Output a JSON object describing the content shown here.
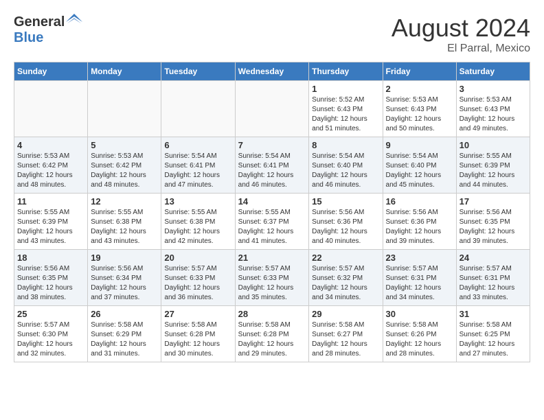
{
  "header": {
    "logo_general": "General",
    "logo_blue": "Blue",
    "title": "August 2024",
    "subtitle": "El Parral, Mexico"
  },
  "days_of_week": [
    "Sunday",
    "Monday",
    "Tuesday",
    "Wednesday",
    "Thursday",
    "Friday",
    "Saturday"
  ],
  "weeks": [
    [
      {
        "day": "",
        "info": ""
      },
      {
        "day": "",
        "info": ""
      },
      {
        "day": "",
        "info": ""
      },
      {
        "day": "",
        "info": ""
      },
      {
        "day": "1",
        "info": "Sunrise: 5:52 AM\nSunset: 6:43 PM\nDaylight: 12 hours\nand 51 minutes."
      },
      {
        "day": "2",
        "info": "Sunrise: 5:53 AM\nSunset: 6:43 PM\nDaylight: 12 hours\nand 50 minutes."
      },
      {
        "day": "3",
        "info": "Sunrise: 5:53 AM\nSunset: 6:43 PM\nDaylight: 12 hours\nand 49 minutes."
      }
    ],
    [
      {
        "day": "4",
        "info": "Sunrise: 5:53 AM\nSunset: 6:42 PM\nDaylight: 12 hours\nand 48 minutes."
      },
      {
        "day": "5",
        "info": "Sunrise: 5:53 AM\nSunset: 6:42 PM\nDaylight: 12 hours\nand 48 minutes."
      },
      {
        "day": "6",
        "info": "Sunrise: 5:54 AM\nSunset: 6:41 PM\nDaylight: 12 hours\nand 47 minutes."
      },
      {
        "day": "7",
        "info": "Sunrise: 5:54 AM\nSunset: 6:41 PM\nDaylight: 12 hours\nand 46 minutes."
      },
      {
        "day": "8",
        "info": "Sunrise: 5:54 AM\nSunset: 6:40 PM\nDaylight: 12 hours\nand 46 minutes."
      },
      {
        "day": "9",
        "info": "Sunrise: 5:54 AM\nSunset: 6:40 PM\nDaylight: 12 hours\nand 45 minutes."
      },
      {
        "day": "10",
        "info": "Sunrise: 5:55 AM\nSunset: 6:39 PM\nDaylight: 12 hours\nand 44 minutes."
      }
    ],
    [
      {
        "day": "11",
        "info": "Sunrise: 5:55 AM\nSunset: 6:39 PM\nDaylight: 12 hours\nand 43 minutes."
      },
      {
        "day": "12",
        "info": "Sunrise: 5:55 AM\nSunset: 6:38 PM\nDaylight: 12 hours\nand 43 minutes."
      },
      {
        "day": "13",
        "info": "Sunrise: 5:55 AM\nSunset: 6:38 PM\nDaylight: 12 hours\nand 42 minutes."
      },
      {
        "day": "14",
        "info": "Sunrise: 5:55 AM\nSunset: 6:37 PM\nDaylight: 12 hours\nand 41 minutes."
      },
      {
        "day": "15",
        "info": "Sunrise: 5:56 AM\nSunset: 6:36 PM\nDaylight: 12 hours\nand 40 minutes."
      },
      {
        "day": "16",
        "info": "Sunrise: 5:56 AM\nSunset: 6:36 PM\nDaylight: 12 hours\nand 39 minutes."
      },
      {
        "day": "17",
        "info": "Sunrise: 5:56 AM\nSunset: 6:35 PM\nDaylight: 12 hours\nand 39 minutes."
      }
    ],
    [
      {
        "day": "18",
        "info": "Sunrise: 5:56 AM\nSunset: 6:35 PM\nDaylight: 12 hours\nand 38 minutes."
      },
      {
        "day": "19",
        "info": "Sunrise: 5:56 AM\nSunset: 6:34 PM\nDaylight: 12 hours\nand 37 minutes."
      },
      {
        "day": "20",
        "info": "Sunrise: 5:57 AM\nSunset: 6:33 PM\nDaylight: 12 hours\nand 36 minutes."
      },
      {
        "day": "21",
        "info": "Sunrise: 5:57 AM\nSunset: 6:33 PM\nDaylight: 12 hours\nand 35 minutes."
      },
      {
        "day": "22",
        "info": "Sunrise: 5:57 AM\nSunset: 6:32 PM\nDaylight: 12 hours\nand 34 minutes."
      },
      {
        "day": "23",
        "info": "Sunrise: 5:57 AM\nSunset: 6:31 PM\nDaylight: 12 hours\nand 34 minutes."
      },
      {
        "day": "24",
        "info": "Sunrise: 5:57 AM\nSunset: 6:31 PM\nDaylight: 12 hours\nand 33 minutes."
      }
    ],
    [
      {
        "day": "25",
        "info": "Sunrise: 5:57 AM\nSunset: 6:30 PM\nDaylight: 12 hours\nand 32 minutes."
      },
      {
        "day": "26",
        "info": "Sunrise: 5:58 AM\nSunset: 6:29 PM\nDaylight: 12 hours\nand 31 minutes."
      },
      {
        "day": "27",
        "info": "Sunrise: 5:58 AM\nSunset: 6:28 PM\nDaylight: 12 hours\nand 30 minutes."
      },
      {
        "day": "28",
        "info": "Sunrise: 5:58 AM\nSunset: 6:28 PM\nDaylight: 12 hours\nand 29 minutes."
      },
      {
        "day": "29",
        "info": "Sunrise: 5:58 AM\nSunset: 6:27 PM\nDaylight: 12 hours\nand 28 minutes."
      },
      {
        "day": "30",
        "info": "Sunrise: 5:58 AM\nSunset: 6:26 PM\nDaylight: 12 hours\nand 28 minutes."
      },
      {
        "day": "31",
        "info": "Sunrise: 5:58 AM\nSunset: 6:25 PM\nDaylight: 12 hours\nand 27 minutes."
      }
    ]
  ]
}
